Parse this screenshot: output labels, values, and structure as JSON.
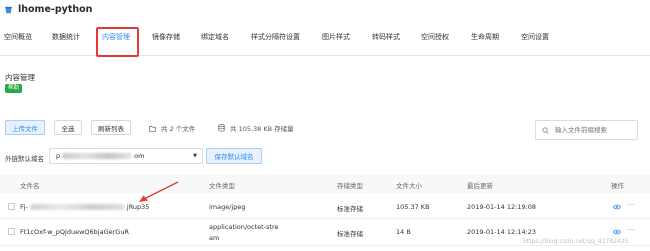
{
  "bucket": {
    "name": "lhome-python"
  },
  "tabs": [
    {
      "label": "空间概览",
      "active": false
    },
    {
      "label": "数据统计",
      "active": false
    },
    {
      "label": "内容管理",
      "active": true
    },
    {
      "label": "镜像存储",
      "active": false
    },
    {
      "label": "绑定域名",
      "active": false
    },
    {
      "label": "样式分隔符设置",
      "active": false
    },
    {
      "label": "图片样式",
      "active": false
    },
    {
      "label": "转码样式",
      "active": false
    },
    {
      "label": "空间授权",
      "active": false
    },
    {
      "label": "生命周期",
      "active": false
    },
    {
      "label": "空间设置",
      "active": false
    }
  ],
  "content": {
    "title": "内容管理",
    "help_label": "帮助"
  },
  "toolbar": {
    "upload_label": "上传文件",
    "select_all_label": "全选",
    "refresh_label": "刷新列表",
    "file_count_text": "共 2 个文件",
    "storage_text": "共 105.38 KB 存储量"
  },
  "search": {
    "placeholder": "输入文件前缀搜索"
  },
  "domain": {
    "label": "外链默认域名",
    "prefix": "p",
    "suffix": "om",
    "save_label": "保存默认域名"
  },
  "table": {
    "columns": [
      "文件名",
      "文件类型",
      "存储类型",
      "文件大小",
      "最后更新",
      "操作"
    ],
    "rows": [
      {
        "name_prefix": "Fj-",
        "name_suffix": "jRup35",
        "type": "image/jpeg",
        "storage": "标准存储",
        "size": "105.37 KB",
        "updated": "2019-01-14 12:19:08"
      },
      {
        "name": "Ft1cOxf-w_pQjduewQ6bjaGerGuR",
        "type_line1": "application/octet-stre",
        "type_line2": "am",
        "storage": "标准存储",
        "size": "14 B",
        "updated": "2019-01-14 12:14:23"
      }
    ]
  },
  "watermark": "https://blog.csdn.net/qq_41782425",
  "colors": {
    "accent": "#2d8cf0",
    "highlight": "#e53935",
    "help_badge": "#2aa745"
  }
}
